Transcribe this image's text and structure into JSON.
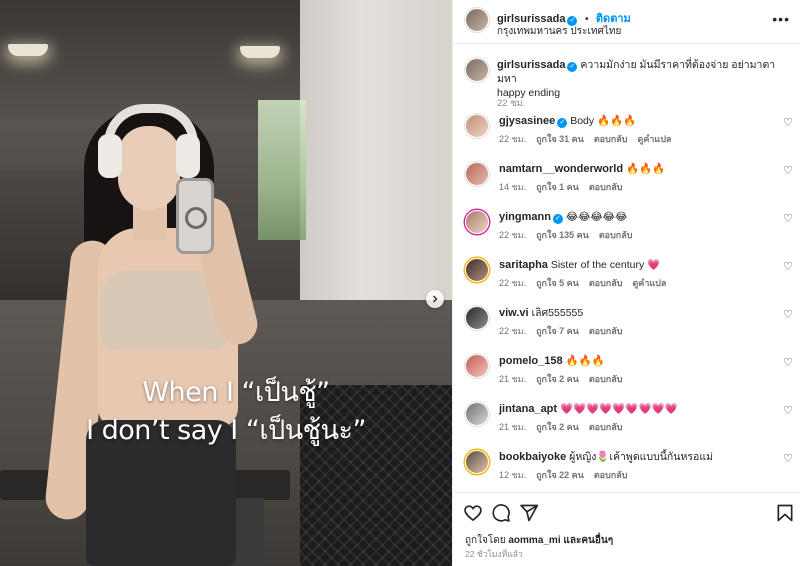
{
  "photo": {
    "overlay_line1": "When I “เป็นชู้”",
    "overlay_line2": "I don’t say I “เป็นชู้นะ”",
    "next_icon": "chevron-right-icon"
  },
  "header": {
    "username": "girlsurissada",
    "separator": "•",
    "follow_label": "ติดตาม",
    "location": "กรุงเทพมหานคร ประเทศไทย",
    "more_icon": "more-horizontal-icon"
  },
  "caption": {
    "username": "girlsurissada",
    "text_line1": "ความมักง่าย มันมีราคาที่ต้องจ่าย อย่ามาตามหา",
    "text_line2": "happy ending",
    "time": "22 ชม."
  },
  "comments": [
    {
      "username": "gjysasinee",
      "verified": true,
      "text": "Body 🔥🔥🔥",
      "time": "22 ชม.",
      "likes": "ถูกใจ 31 คน",
      "reply": "ตอบกลับ",
      "translate": "ดูคำแปล"
    },
    {
      "username": "namtarn__wonderworld",
      "verified": false,
      "text": "🔥🔥🔥",
      "time": "14 ชม.",
      "likes": "ถูกใจ 1 คน",
      "reply": "ตอบกลับ",
      "translate": ""
    },
    {
      "username": "yingmann",
      "verified": true,
      "text": "😂😂😂😂😂",
      "time": "22 ชม.",
      "likes": "ถูกใจ 135 คน",
      "reply": "ตอบกลับ",
      "translate": ""
    },
    {
      "username": "saritapha",
      "verified": false,
      "text": "Sister of the century 💗",
      "time": "22 ชม.",
      "likes": "ถูกใจ 5 คน",
      "reply": "ตอบกลับ",
      "translate": "ดูคำแปล"
    },
    {
      "username": "viw.vi",
      "verified": false,
      "text": "เลิศ555555",
      "time": "22 ชม.",
      "likes": "ถูกใจ 7 คน",
      "reply": "ตอบกลับ",
      "translate": ""
    },
    {
      "username": "pomelo_158",
      "verified": false,
      "text": "🔥🔥🔥",
      "time": "21 ชม.",
      "likes": "ถูกใจ 2 คน",
      "reply": "ตอบกลับ",
      "translate": ""
    },
    {
      "username": "jintana_apt",
      "verified": false,
      "text": "💗💗💗💗💗💗💗💗💗",
      "time": "21 ชม.",
      "likes": "ถูกใจ 2 คน",
      "reply": "ตอบกลับ",
      "translate": ""
    },
    {
      "username": "bookbaiyoke",
      "verified": false,
      "text": "ผู้หญิง🌷เค้าพูดแบบนี้กันหรอแม่",
      "time": "12 ชม.",
      "likes": "ถูกใจ 22 คน",
      "reply": "ตอบกลับ",
      "translate": ""
    }
  ],
  "actions": {
    "like_icon": "heart-icon",
    "comment_icon": "comment-icon",
    "share_icon": "share-icon",
    "save_icon": "bookmark-icon",
    "liked_by_prefix": "ถูกใจโดย",
    "liked_by_user": "aomma_mi",
    "liked_by_suffix": "และคนอื่นๆ",
    "post_time": "22 ชั่วโมงที่แล้ว"
  },
  "colors": {
    "accent": "#0095f6",
    "text": "#262626",
    "muted": "#8e8e8e",
    "like": "#ed4956"
  }
}
